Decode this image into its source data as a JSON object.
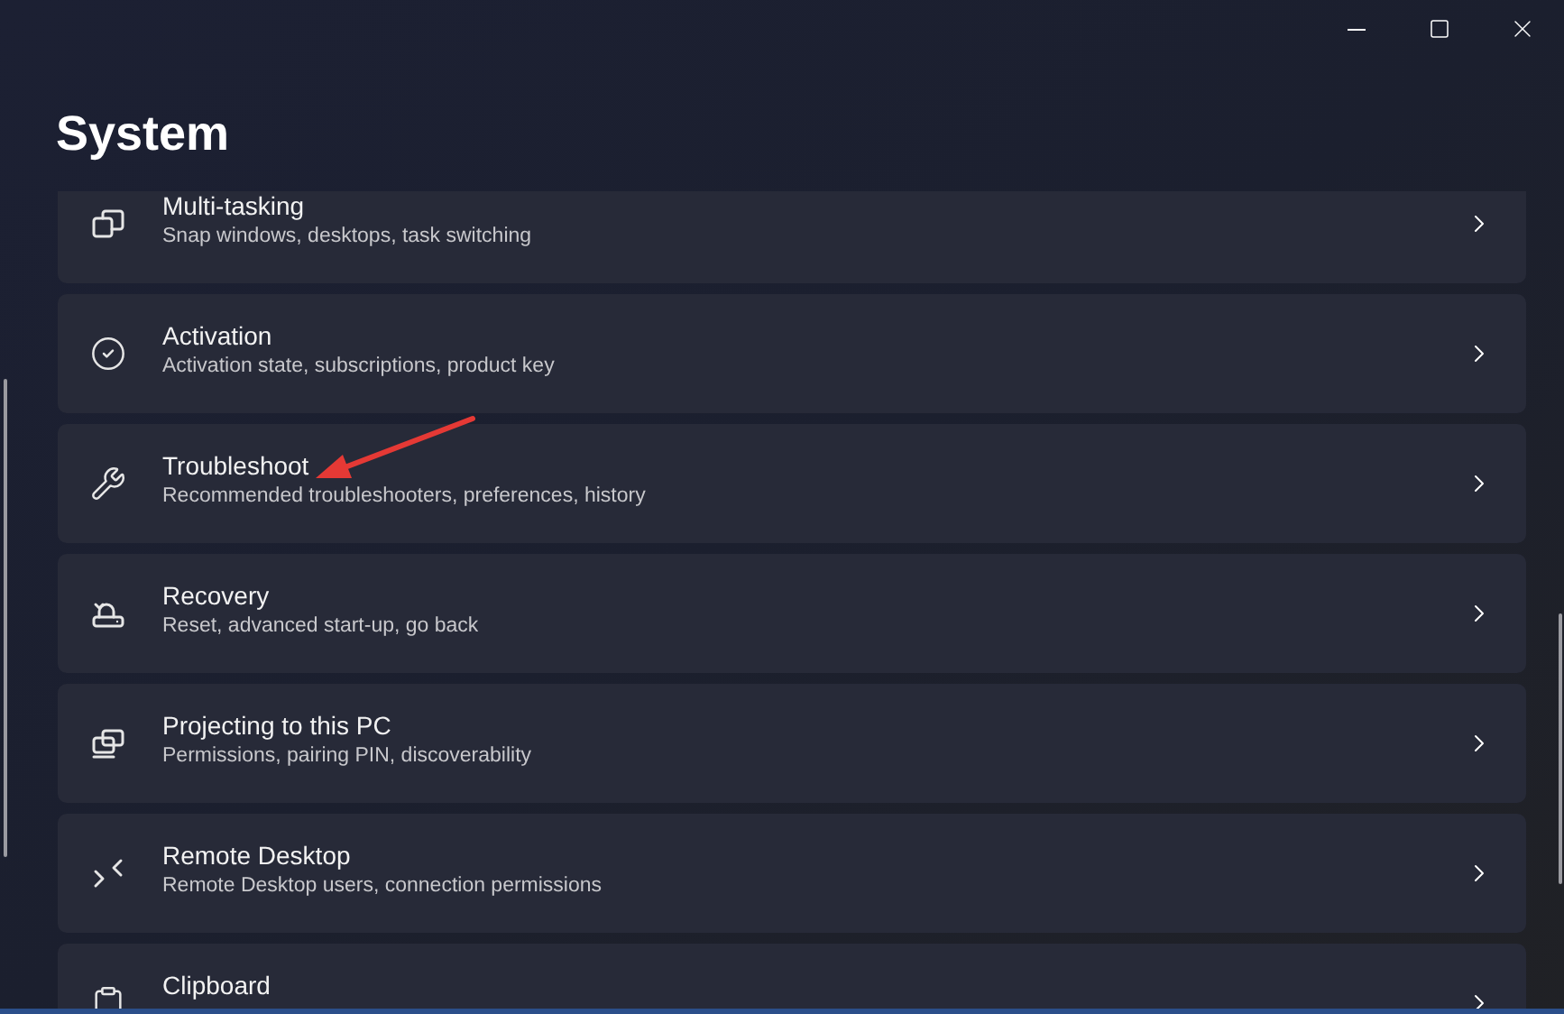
{
  "page_title": "System",
  "items": [
    {
      "title": "Multi-tasking",
      "subtitle": "Snap windows, desktops, task switching"
    },
    {
      "title": "Activation",
      "subtitle": "Activation state, subscriptions, product key"
    },
    {
      "title": "Troubleshoot",
      "subtitle": "Recommended troubleshooters, preferences, history"
    },
    {
      "title": "Recovery",
      "subtitle": "Reset, advanced start-up, go back"
    },
    {
      "title": "Projecting to this PC",
      "subtitle": "Permissions, pairing PIN, discoverability"
    },
    {
      "title": "Remote Desktop",
      "subtitle": "Remote Desktop users, connection permissions"
    },
    {
      "title": "Clipboard"
    }
  ]
}
